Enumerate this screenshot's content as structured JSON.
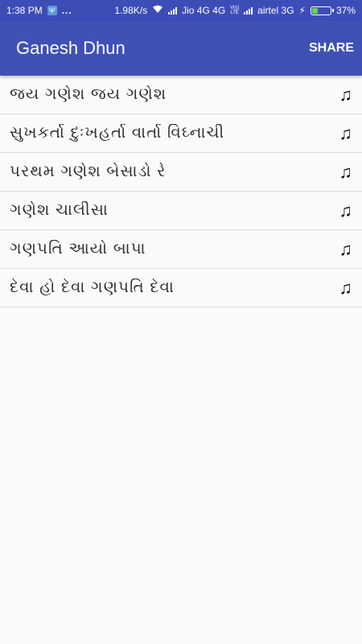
{
  "status_bar": {
    "time": "1:38 PM",
    "usb_symbol": "Ψ",
    "dots": "...",
    "speed": "1.98K/s",
    "wifi_icon": "wifi-icon",
    "carrier1": "Jio 4G 4G",
    "volte_line1": "Vo))",
    "volte_line2": "LTE",
    "carrier2": "airtel 3G",
    "charging_symbol": "⚡",
    "battery_percent": "37%",
    "battery_level": 0.37,
    "battery_fill_color": "#6cd24a"
  },
  "app_bar": {
    "title": "Ganesh Dhun",
    "share_label": "SHARE",
    "background": "#3f51b5"
  },
  "songs": [
    {
      "title": "જય ગણેશ જય ગણેશ",
      "icon": "music-note-icon"
    },
    {
      "title": "સુખકર્તા દુઃખહર્તા વાર્તા વિઘ્નાચી",
      "icon": "music-note-icon"
    },
    {
      "title": "પરથમ ગણેશ બેસાડો રે",
      "icon": "music-note-icon"
    },
    {
      "title": "ગણેશ ચાલીસા",
      "icon": "music-note-icon"
    },
    {
      "title": "ગણપતિ આયો બાપા",
      "icon": "music-note-icon"
    },
    {
      "title": "દેવા હો દેવા ગણપતિ દેવા",
      "icon": "music-note-icon"
    }
  ],
  "music_glyph": "♫"
}
